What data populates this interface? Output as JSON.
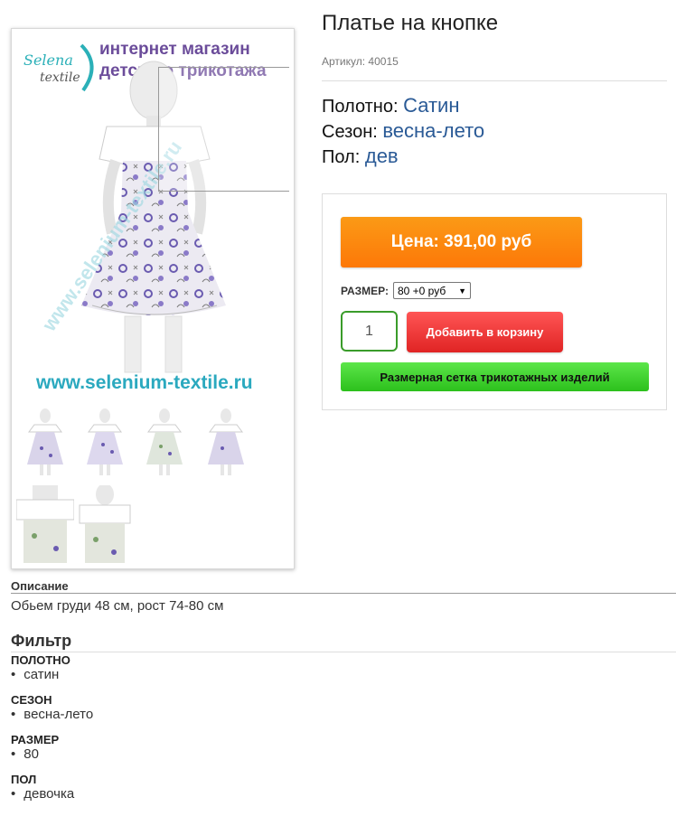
{
  "product": {
    "title": "Платье на кнопке",
    "sku_label": "Артикул:",
    "sku_value": "40015",
    "attributes": [
      {
        "label": "Полотно:",
        "value": "Сатин"
      },
      {
        "label": "Сезон:",
        "value": "весна-лето"
      },
      {
        "label": "Пол:",
        "value": "дев"
      }
    ]
  },
  "gallery": {
    "watermark_line1": "интернет магазин",
    "watermark_line2": "детского трикотажа",
    "logo_line1": "Selena",
    "logo_line2": "textile",
    "site_url": "www.selenium-textile.ru",
    "thumb_count": 6
  },
  "buybox": {
    "price_label": "Цена: 391,00 руб",
    "size_label": "РАЗМЕР:",
    "size_selected": "80 +0 руб",
    "quantity": "1",
    "add_to_cart": "Добавить в корзину",
    "size_chart": "Размерная сетка трикотажных изделий"
  },
  "description": {
    "heading": "Описание",
    "text": "Обьем груди 48 см, рост 74-80 см"
  },
  "filter": {
    "heading": "Фильтр",
    "groups": [
      {
        "label": "ПОЛОТНО",
        "value": "сатин"
      },
      {
        "label": "СЕЗОН",
        "value": "весна-лето"
      },
      {
        "label": "РАЗМЕР",
        "value": "80"
      },
      {
        "label": "ПОЛ",
        "value": "девочка"
      }
    ]
  },
  "colors": {
    "price_orange": "#fd8a0f",
    "cart_red": "#e53030",
    "size_chart_green": "#3fd12d",
    "link_blue": "#2a5a96",
    "qty_border_green": "#3a9c2a"
  }
}
